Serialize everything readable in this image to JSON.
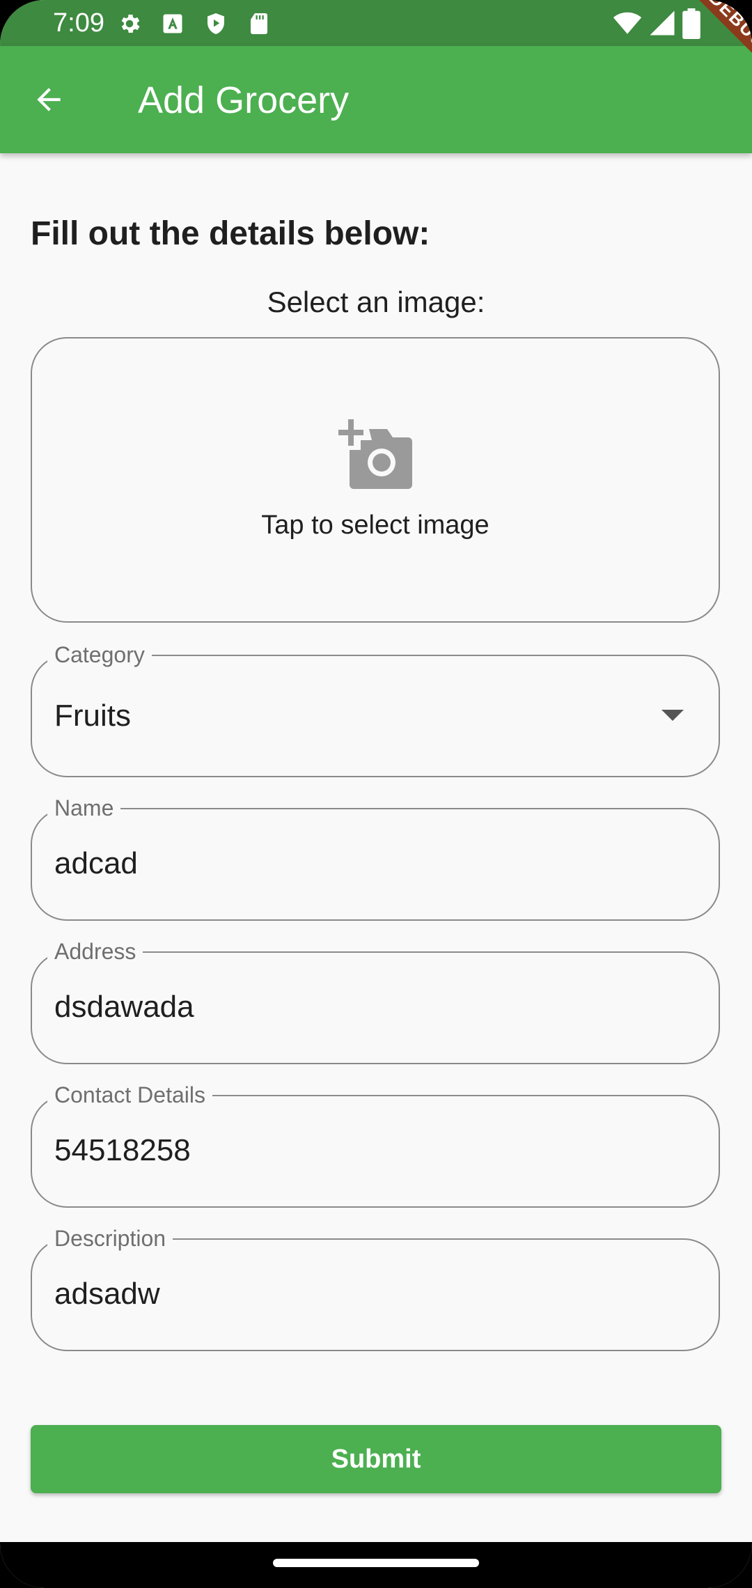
{
  "status_bar": {
    "time": "7:09",
    "left_icons": [
      "gear-icon",
      "text-a-icon",
      "shield-play-icon",
      "sd-card-icon"
    ],
    "right_icons": [
      "wifi-icon",
      "signal-icon",
      "battery-icon"
    ]
  },
  "app_bar": {
    "title": "Add Grocery",
    "back_icon": "arrow-left-icon",
    "color": "#4caf50"
  },
  "debug_banner": "DEBUG",
  "form": {
    "heading": "Fill out the details below:",
    "image_section_label": "Select an image:",
    "image_picker_hint": "Tap to select image",
    "image_picker_icon": "add-a-photo-icon",
    "category": {
      "label": "Category",
      "value": "Fruits"
    },
    "name": {
      "label": "Name",
      "value": "adcad"
    },
    "address": {
      "label": "Address",
      "value": "dsdawada"
    },
    "contact": {
      "label": "Contact Details",
      "value": "54518258"
    },
    "description": {
      "label": "Description",
      "value": "adsadw"
    },
    "submit_label": "Submit"
  }
}
